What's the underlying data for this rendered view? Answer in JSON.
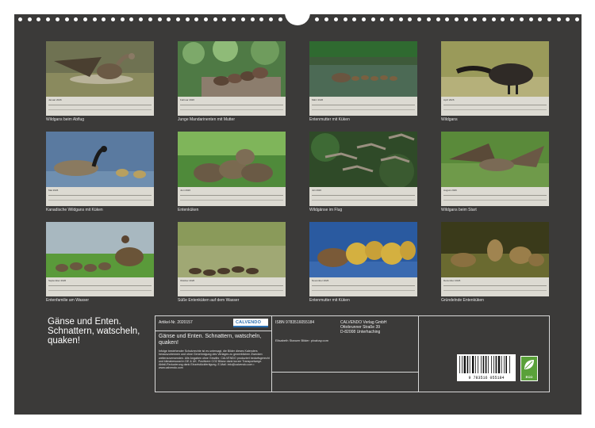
{
  "title": "Gänse und Enten. Schnattern, watscheln, quaken!",
  "tiles": [
    {
      "month": "Januar 2026",
      "caption": "Wildgans beim Abflug"
    },
    {
      "month": "Februar 2026",
      "caption": "Junge Mandarinenten mit Mutter"
    },
    {
      "month": "März 2026",
      "caption": "Entenmutter mit Küken"
    },
    {
      "month": "April 2026",
      "caption": "Wildgans"
    },
    {
      "month": "Mai 2026",
      "caption": "Kanadische Wildgans mit Küken"
    },
    {
      "month": "Juni 2026",
      "caption": "Entenküken"
    },
    {
      "month": "Juli 2026",
      "caption": "Wildgänse im Flug"
    },
    {
      "month": "August 2026",
      "caption": "Wildgans beim Start"
    },
    {
      "month": "September 2026",
      "caption": "Entenfamilie am Wasser"
    },
    {
      "month": "Oktober 2026",
      "caption": "Süße Entenküken auf dem Wasser"
    },
    {
      "month": "November 2026",
      "caption": "Entenmutter mit Küken"
    },
    {
      "month": "Dezember 2026",
      "caption": "Gründelnde Entenküken"
    }
  ],
  "info": {
    "artikel": "Artikel-Nr. 2020157",
    "logo_text": "CALVENDO",
    "subtitle": "Gänse und Enten. Schnattern, watscheln, quaken!",
    "legal": "Infolge bestehender Schutzrechte ist es untersagt, die Bilder dieses Kalenders herauszutrennen und ohne Genehmigung des Verlages zu gewerblichen Zwecken weiterzuverwenden. Alle Angaben ohne Gewähr. CALVENDO produziert bedarfsgerecht und klimabewusst in DE & UK. Positivere CO2 Bilanz dank kurzer Transportwege. Abfall-Reduzierung dank Einzelstückfertigung. E-Mail: info@calvendo.com • www.calvendo.com",
    "isbn": "ISBN 9783516055184",
    "publisher_name": "CALVENDO Verlag GmbH",
    "publisher_street": "Ottobrunner Straße 39",
    "publisher_city": "D-82008 Unterhaching",
    "credit": "Elisabeth Stanzer Bilder: pixabay.com",
    "barcode_number": "9 783516 055184",
    "eco_label": "ECO"
  },
  "colors": {
    "page": "#3b3a39",
    "text": "#f0f0f0",
    "eco": "#5aa13a",
    "logo": "#2a6fb0"
  }
}
